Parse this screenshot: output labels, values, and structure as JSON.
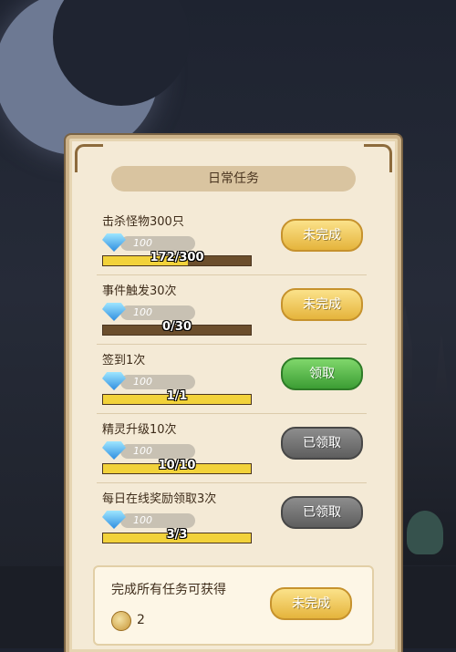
{
  "panel": {
    "title": "日常任务"
  },
  "tasks": [
    {
      "title": "击杀怪物300只",
      "reward": "100",
      "progress_text": "172/300",
      "progress": 0.573,
      "button": "未完成",
      "state": "yellow"
    },
    {
      "title": "事件触发30次",
      "reward": "100",
      "progress_text": "0/30",
      "progress": 0.0,
      "button": "未完成",
      "state": "yellow"
    },
    {
      "title": "签到1次",
      "reward": "100",
      "progress_text": "1/1",
      "progress": 1.0,
      "button": "领取",
      "state": "green"
    },
    {
      "title": "精灵升级10次",
      "reward": "100",
      "progress_text": "10/10",
      "progress": 1.0,
      "button": "已领取",
      "state": "gray"
    },
    {
      "title": "每日在线奖励领取3次",
      "reward": "100",
      "progress_text": "3/3",
      "progress": 1.0,
      "button": "已领取",
      "state": "gray"
    }
  ],
  "summary": {
    "title": "完成所有任务可获得",
    "coin_count": "2",
    "button": "未完成"
  },
  "colors": {
    "progress_fill": "#f2d23a",
    "progress_bg": "#6b4e2c",
    "panel_bg": "#f4ead6"
  }
}
